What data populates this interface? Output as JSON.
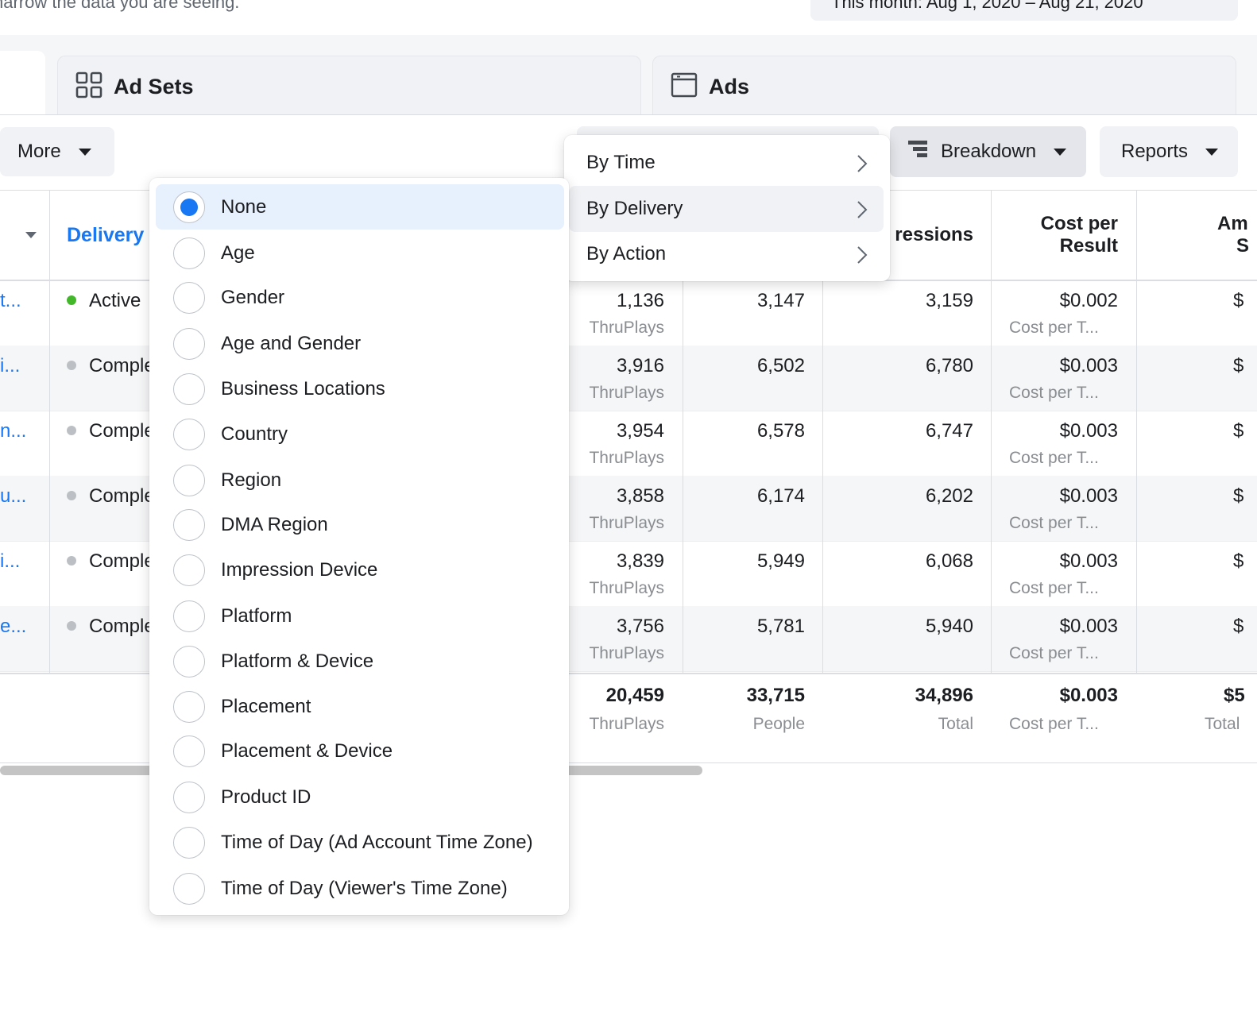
{
  "header": {
    "hint_text": "narrow the data you are seeing.",
    "date_range": "This month: Aug 1, 2020 – Aug 21, 2020"
  },
  "tabs": [
    {
      "label": "Ad Sets",
      "icon": "grid-icon"
    },
    {
      "label": "Ads",
      "icon": "window-icon"
    }
  ],
  "toolbar": {
    "more_label": "More",
    "breakdown_label": "Breakdown",
    "reports_label": "Reports"
  },
  "breakdown_menu": {
    "items": [
      {
        "label": "By Time",
        "active": false
      },
      {
        "label": "By Delivery",
        "active": true
      },
      {
        "label": "By Action",
        "active": false
      }
    ]
  },
  "delivery_options": {
    "selected": "None",
    "items": [
      "None",
      "Age",
      "Gender",
      "Age and Gender",
      "Business Locations",
      "Country",
      "Region",
      "DMA Region",
      "Impression Device",
      "Platform",
      "Platform & Device",
      "Placement",
      "Placement & Device",
      "Product ID",
      "Time of Day (Ad Account Time Zone)",
      "Time of Day (Viewer's Time Zone)"
    ]
  },
  "table": {
    "headers": {
      "delivery": "Delivery",
      "impressions": "ressions",
      "cost_per_result_1": "Cost per",
      "cost_per_result_2": "Result",
      "amount_1": "Am",
      "amount_2": "S"
    },
    "rows": [
      {
        "name": "t...",
        "status": "Active",
        "status_color": "#42b72a",
        "results": "1,136",
        "results_sub": "ThruPlays",
        "reach": "3,147",
        "impressions": "3,159",
        "cost": "$0.002",
        "cost_sub": "Cost per T...",
        "amount": "$"
      },
      {
        "name": "i...",
        "status": "Comple",
        "status_color": "#bcc0c4",
        "results": "3,916",
        "results_sub": "ThruPlays",
        "reach": "6,502",
        "impressions": "6,780",
        "cost": "$0.003",
        "cost_sub": "Cost per T...",
        "amount": "$"
      },
      {
        "name": "n...",
        "status": "Comple",
        "status_color": "#bcc0c4",
        "results": "3,954",
        "results_sub": "ThruPlays",
        "reach": "6,578",
        "impressions": "6,747",
        "cost": "$0.003",
        "cost_sub": "Cost per T...",
        "amount": "$"
      },
      {
        "name": "u...",
        "status": "Comple",
        "status_color": "#bcc0c4",
        "results": "3,858",
        "results_sub": "ThruPlays",
        "reach": "6,174",
        "impressions": "6,202",
        "cost": "$0.003",
        "cost_sub": "Cost per T...",
        "amount": "$"
      },
      {
        "name": "i...",
        "status": "Comple",
        "status_color": "#bcc0c4",
        "results": "3,839",
        "results_sub": "ThruPlays",
        "reach": "5,949",
        "impressions": "6,068",
        "cost": "$0.003",
        "cost_sub": "Cost per T...",
        "amount": "$"
      },
      {
        "name": "e...",
        "status": "Comple",
        "status_color": "#bcc0c4",
        "results": "3,756",
        "results_sub": "ThruPlays",
        "reach": "5,781",
        "impressions": "5,940",
        "cost": "$0.003",
        "cost_sub": "Cost per T...",
        "amount": "$"
      }
    ],
    "totals": {
      "results": "20,459",
      "results_sub": "ThruPlays",
      "reach": "33,715",
      "reach_sub": "People",
      "impressions": "34,896",
      "impressions_sub": "Total",
      "cost": "$0.003",
      "cost_sub": "Cost per T...",
      "amount": "$5",
      "amount_sub": "Total"
    }
  }
}
